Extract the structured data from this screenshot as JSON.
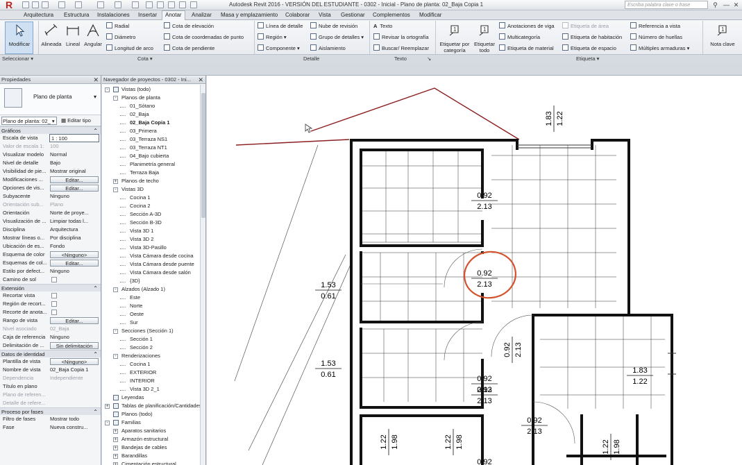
{
  "app": {
    "title": "Autodesk Revit 2016 - VERSIÓN DEL ESTUDIANTE -   0302 - Inicial - Plano de planta: 02_Baja Copia 1",
    "logo_letter": "R",
    "search_placeholder": "Escriba palabra clave o frase"
  },
  "tabs": [
    "Arquitectura",
    "Estructura",
    "Instalaciones",
    "Insertar",
    "Anotar",
    "Analizar",
    "Masa y emplazamiento",
    "Colaborar",
    "Vista",
    "Gestionar",
    "Complementos",
    "Modificar"
  ],
  "active_tab": "Anotar",
  "ribbon": {
    "modificar": "Modificar",
    "alineada": "Alineada",
    "lineal": "Lineal",
    "angular": "Angular",
    "radial": "Radial",
    "diametro": "Diámetro",
    "longitud_arco": "Longitud de arco",
    "cota_elevacion": "Cota de elevación",
    "cota_coordenadas": "Cota de coordenadas de punto",
    "cota_pendiente": "Cota de pendiente",
    "linea_detalle": "Línea de detalle",
    "region": "Región",
    "componente": "Componente",
    "nube_revision": "Nube de revisión",
    "grupo_detalles": "Grupo de detalles",
    "aislamiento": "Aislamiento",
    "texto": "Texto",
    "revisar_ortografia": "Revisar la ortografía",
    "buscar_reemplazar": "Buscar/ Reemplazar",
    "etiquetar_categoria_1": "Etiquetar por",
    "etiquetar_categoria_2": "categoría",
    "etiquetar_todo_1": "Etiquetar",
    "etiquetar_todo_2": "todo",
    "anotaciones_viga": "Anotaciones de viga",
    "multicategoria": "Multicategoría",
    "etiqueta_material": "Etiqueta de material",
    "etiqueta_area": "Etiqueta de área",
    "etiqueta_habitacion": "Etiqueta de habitación",
    "etiqueta_espacio": "Etiqueta de espacio",
    "referencia_vista": "Referencia a vista",
    "numero_huellas": "Número de huellas",
    "multiples_armaduras": "Múltiples armaduras",
    "nota_clave": "Nota clave",
    "groups": {
      "seleccionar": "Seleccionar",
      "cota": "Cota",
      "detalle": "Detalle",
      "texto": "Texto",
      "etiqueta": "Etiqueta"
    }
  },
  "properties": {
    "title": "Propiedades",
    "type_name": "Plano de planta",
    "selector": "Plano de planta: 02_",
    "edit_type": "Editar tipo",
    "sections": {
      "graficos": "Gráficos",
      "extension": "Extensión",
      "identidad": "Datos de identidad",
      "fases": "Proceso por fases"
    },
    "graficos_rows": [
      {
        "k": "Escala de vista",
        "v": "1 : 100",
        "kind": "input"
      },
      {
        "k": "Valor de escala    1:",
        "v": "100",
        "kind": "dis"
      },
      {
        "k": "Visualizar modelo",
        "v": "Normal"
      },
      {
        "k": "Nivel de detalle",
        "v": "Bajo"
      },
      {
        "k": "Visibilidad de pie...",
        "v": "Mostrar original"
      },
      {
        "k": "Modificaciones ...",
        "v": "Editar...",
        "kind": "btn"
      },
      {
        "k": "Opciones de vis...",
        "v": "Editar...",
        "kind": "btn"
      },
      {
        "k": "Subyacente",
        "v": "Ninguno"
      },
      {
        "k": "Orientación sub...",
        "v": "Plano",
        "kind": "dis"
      },
      {
        "k": "Orientación",
        "v": "Norte de proye..."
      },
      {
        "k": "Visualización de ...",
        "v": "Limpiar todas l..."
      },
      {
        "k": "Disciplina",
        "v": "Arquitectura"
      },
      {
        "k": "Mostrar líneas o...",
        "v": "Por disciplina"
      },
      {
        "k": "Ubicación de es...",
        "v": "Fondo"
      },
      {
        "k": "Esquema de color",
        "v": "<Ninguno>",
        "kind": "btn"
      },
      {
        "k": "Esquemas de col...",
        "v": "Editar...",
        "kind": "btn"
      },
      {
        "k": "Estilo por defect...",
        "v": "Ninguno"
      },
      {
        "k": "Camino de sol",
        "v": "",
        "kind": "cb"
      }
    ],
    "extension_rows": [
      {
        "k": "Recortar vista",
        "v": "",
        "kind": "cb"
      },
      {
        "k": "Región de recort...",
        "v": "",
        "kind": "cb"
      },
      {
        "k": "Recorte de anota...",
        "v": "",
        "kind": "cb"
      },
      {
        "k": "Rango de vista",
        "v": "Editar...",
        "kind": "btn"
      },
      {
        "k": "Nivel asociado",
        "v": "02_Baja",
        "kind": "dis"
      },
      {
        "k": "Caja de referencia",
        "v": "Ninguno"
      },
      {
        "k": "Delimitación de ...",
        "v": "Sin delimitación",
        "kind": "btn"
      }
    ],
    "identidad_rows": [
      {
        "k": "Plantilla de vista",
        "v": "<Ninguno>",
        "kind": "btn"
      },
      {
        "k": "Nombre de vista",
        "v": "02_Baja Copia 1"
      },
      {
        "k": "Dependencia",
        "v": "Independiente",
        "kind": "dis"
      },
      {
        "k": "Título en plano",
        "v": ""
      },
      {
        "k": "Plano de referen...",
        "v": "",
        "kind": "dis"
      },
      {
        "k": "Detalle de refere...",
        "v": "",
        "kind": "dis"
      }
    ],
    "fases_rows": [
      {
        "k": "Filtro de fases",
        "v": "Mostrar todo"
      },
      {
        "k": "Fase",
        "v": "Nueva constru..."
      }
    ]
  },
  "browser": {
    "title": "Navegador de proyectos - 0302 - Ini...",
    "nodes": [
      {
        "t": "Vistas (todo)",
        "lvl": 0,
        "tog": "-",
        "icon": true
      },
      {
        "t": "Planos de planta",
        "lvl": 1,
        "tog": "-"
      },
      {
        "t": "01_Sótano",
        "lvl": 2
      },
      {
        "t": "02_Baja",
        "lvl": 2
      },
      {
        "t": "02_Baja Copia 1",
        "lvl": 2,
        "bold": true
      },
      {
        "t": "03_Primera",
        "lvl": 2
      },
      {
        "t": "03_Terraza NS1",
        "lvl": 2
      },
      {
        "t": "03_Terraza NT1",
        "lvl": 2
      },
      {
        "t": "04_Bajo cubierta",
        "lvl": 2
      },
      {
        "t": "Planimetría general",
        "lvl": 2
      },
      {
        "t": "Terraza Baja",
        "lvl": 2
      },
      {
        "t": "Planos de techo",
        "lvl": 1,
        "tog": "+"
      },
      {
        "t": "Vistas 3D",
        "lvl": 1,
        "tog": "-"
      },
      {
        "t": "Cocina 1",
        "lvl": 2
      },
      {
        "t": "Cocina 2",
        "lvl": 2
      },
      {
        "t": "Sección A-3D",
        "lvl": 2
      },
      {
        "t": "Sección B-3D",
        "lvl": 2
      },
      {
        "t": "Vista 3D 1",
        "lvl": 2
      },
      {
        "t": "Vista 3D 2",
        "lvl": 2
      },
      {
        "t": "Vista 3D-Pasillo",
        "lvl": 2
      },
      {
        "t": "Vista Cámara desde cocina",
        "lvl": 2
      },
      {
        "t": "Vista Cámara desde puente",
        "lvl": 2
      },
      {
        "t": "Vista Cámara desde salón",
        "lvl": 2
      },
      {
        "t": "{3D}",
        "lvl": 2
      },
      {
        "t": "Alzados (Alzado 1)",
        "lvl": 1,
        "tog": "-"
      },
      {
        "t": "Este",
        "lvl": 2
      },
      {
        "t": "Norte",
        "lvl": 2
      },
      {
        "t": "Oeste",
        "lvl": 2
      },
      {
        "t": "Sur",
        "lvl": 2
      },
      {
        "t": "Secciones (Sección 1)",
        "lvl": 1,
        "tog": "-"
      },
      {
        "t": "Sección 1",
        "lvl": 2
      },
      {
        "t": "Sección 2",
        "lvl": 2
      },
      {
        "t": "Renderizaciones",
        "lvl": 1,
        "tog": "-"
      },
      {
        "t": "Cocina 1",
        "lvl": 2
      },
      {
        "t": "EXTERIOR",
        "lvl": 2
      },
      {
        "t": "INTERIOR",
        "lvl": 2
      },
      {
        "t": "Vista 3D 2_1",
        "lvl": 2
      },
      {
        "t": "Leyendas",
        "lvl": 0,
        "icon": true
      },
      {
        "t": "Tablas de planificación/Cantidades",
        "lvl": 0,
        "tog": "+",
        "icon": true
      },
      {
        "t": "Planos (todo)",
        "lvl": 0,
        "icon": true
      },
      {
        "t": "Familias",
        "lvl": 0,
        "tog": "-",
        "icon": true
      },
      {
        "t": "Aparatos sanitarios",
        "lvl": 1,
        "tog": "+"
      },
      {
        "t": "Armazón estructural",
        "lvl": 1,
        "tog": "+"
      },
      {
        "t": "Bandejas de cables",
        "lvl": 1,
        "tog": "+"
      },
      {
        "t": "Barandillas",
        "lvl": 1,
        "tog": "+"
      },
      {
        "t": "Cimentación estructural",
        "lvl": 1,
        "tog": "+"
      }
    ]
  },
  "drawing": {
    "tags": [
      {
        "a": "0.92",
        "b": "2.13"
      },
      {
        "a": "0.92",
        "b": "2.13"
      },
      {
        "a": "1.53",
        "b": "0.61"
      },
      {
        "a": "1.53",
        "b": "0.61"
      },
      {
        "a": "0.92",
        "b": "2.13"
      },
      {
        "a": "0.92",
        "b": "2.13"
      },
      {
        "a": "1.83",
        "b": "1.22"
      },
      {
        "a": "0.92",
        "b": "2.13"
      },
      {
        "a": "0.92",
        "b": ""
      }
    ],
    "vtags": [
      {
        "a": "1.83",
        "b": "1.22"
      },
      {
        "a": "0.92",
        "b": "2.13"
      },
      {
        "a": "1.22",
        "b": "1.98"
      },
      {
        "a": "1.22",
        "b": "1.98"
      },
      {
        "a": "1.22",
        "b": "1.98"
      }
    ],
    "colors": {
      "wall": "#111111",
      "roof": "#8b1e1e",
      "highlight": "#d4532f"
    }
  }
}
